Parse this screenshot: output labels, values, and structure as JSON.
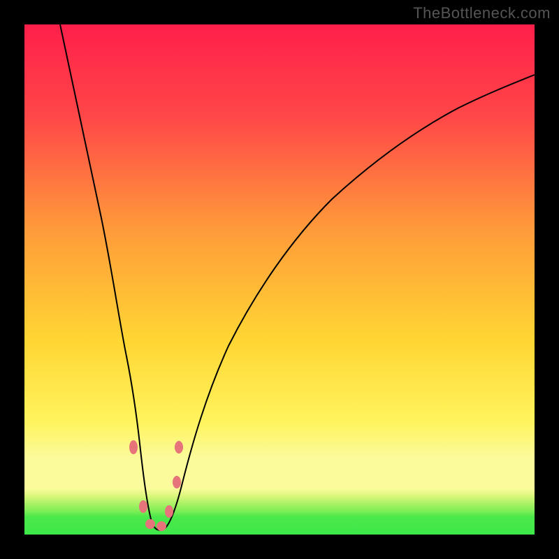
{
  "watermark": "TheBottleneck.com",
  "chart_data": {
    "type": "line",
    "title": "",
    "xlabel": "",
    "ylabel": "",
    "xlim": [
      0,
      100
    ],
    "ylim": [
      0,
      100
    ],
    "x": [
      7,
      10,
      13,
      15,
      17,
      18.5,
      20,
      21,
      22,
      23,
      24,
      25,
      26,
      27,
      28,
      30,
      33,
      36,
      40,
      45,
      50,
      55,
      60,
      65,
      70,
      75,
      80,
      85,
      90,
      95,
      100
    ],
    "values": [
      100,
      86,
      72,
      62,
      50,
      40,
      30,
      22,
      15,
      8,
      3.5,
      1.5,
      1,
      1.5,
      3,
      8,
      18,
      27,
      37,
      47,
      55,
      61,
      66.5,
      71,
      74.5,
      77.5,
      80,
      82,
      83.8,
      85.3,
      86.5
    ],
    "marker_points": [
      {
        "x": 21.3,
        "y": 17
      },
      {
        "x": 23.2,
        "y": 5
      },
      {
        "x": 24.7,
        "y": 2
      },
      {
        "x": 26.8,
        "y": 2
      },
      {
        "x": 28.3,
        "y": 5
      },
      {
        "x": 29.8,
        "y": 10
      },
      {
        "x": 30.2,
        "y": 17
      }
    ],
    "bands": [
      {
        "color": "#4be84b",
        "y_start": 0,
        "y_end": 3.5
      },
      {
        "color": "gradient_green_yellow",
        "y_start": 3.5,
        "y_end": 8
      },
      {
        "color": "#fbfb9b",
        "y_start": 8,
        "y_end": 22
      },
      {
        "color": "gradient_yellow_orange_red",
        "y_start": 22,
        "y_end": 100
      }
    ]
  }
}
